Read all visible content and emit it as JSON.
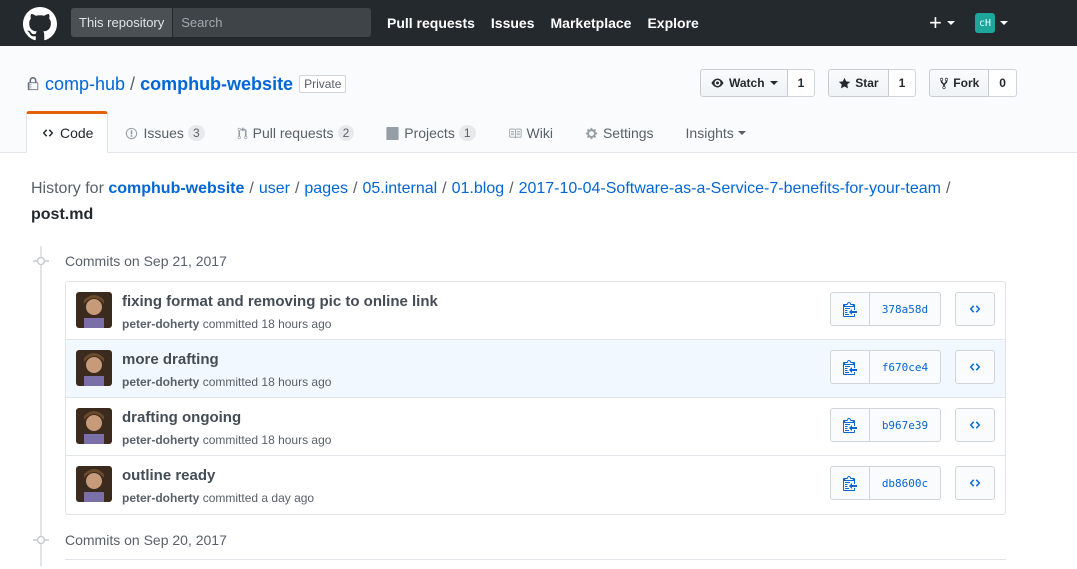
{
  "header": {
    "search_scope": "This repository",
    "search_placeholder": "Search",
    "nav": [
      "Pull requests",
      "Issues",
      "Marketplace",
      "Explore"
    ],
    "plus_label": "+",
    "avatar_initials": "cH"
  },
  "repo": {
    "owner": "comp-hub",
    "separator": "/",
    "name": "comphub-website",
    "visibility": "Private",
    "watch": {
      "label": "Watch",
      "count": "1"
    },
    "star": {
      "label": "Star",
      "count": "1"
    },
    "fork": {
      "label": "Fork",
      "count": "0"
    }
  },
  "tabs": [
    {
      "label": "Code",
      "icon": "code-icon",
      "counter": ""
    },
    {
      "label": "Issues",
      "icon": "issue-icon",
      "counter": "3"
    },
    {
      "label": "Pull requests",
      "icon": "pull-request-icon",
      "counter": "2"
    },
    {
      "label": "Projects",
      "icon": "project-icon",
      "counter": "1"
    },
    {
      "label": "Wiki",
      "icon": "book-icon",
      "counter": ""
    },
    {
      "label": "Settings",
      "icon": "gear-icon",
      "counter": ""
    },
    {
      "label": "Insights",
      "icon": "",
      "counter": ""
    }
  ],
  "breadcrumb": {
    "prefix": "History for",
    "root": "comphub-website",
    "segments": [
      "user",
      "pages",
      "05.internal",
      "01.blog",
      "2017-10-04-Software-as-a-Service-7-benefits-for-your-team"
    ],
    "file": "post.md"
  },
  "groups": [
    {
      "title": "Commits on Sep 21, 2017"
    },
    {
      "title": "Commits on Sep 20, 2017"
    }
  ],
  "commits": [
    {
      "message": "fixing format and removing pic to online link",
      "author": "peter-doherty",
      "action": "committed",
      "time": "18 hours ago",
      "sha": "378a58d"
    },
    {
      "message": "more drafting",
      "author": "peter-doherty",
      "action": "committed",
      "time": "18 hours ago",
      "sha": "f670ce4"
    },
    {
      "message": "drafting ongoing",
      "author": "peter-doherty",
      "action": "committed",
      "time": "18 hours ago",
      "sha": "b967e39"
    },
    {
      "message": "outline ready",
      "author": "peter-doherty",
      "action": "committed",
      "time": "a day ago",
      "sha": "db8600c"
    }
  ],
  "colors": {
    "link": "#0366d6",
    "header_bg": "#24292e",
    "selected_tab": "#e36209",
    "highlight_row": "#f1f8ff"
  }
}
